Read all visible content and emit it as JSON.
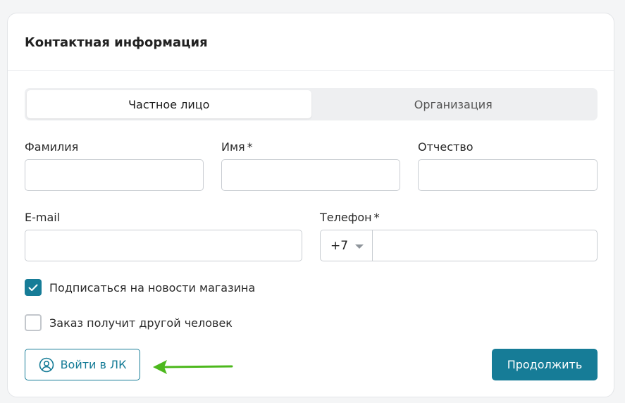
{
  "section": {
    "title": "Контактная информация"
  },
  "tabs": [
    {
      "label": "Частное лицо",
      "active": true
    },
    {
      "label": "Организация",
      "active": false
    }
  ],
  "fields": {
    "last_name": {
      "label": "Фамилия",
      "value": ""
    },
    "first_name": {
      "label": "Имя",
      "required": "*",
      "value": ""
    },
    "middle_name": {
      "label": "Отчество",
      "value": ""
    },
    "email": {
      "label": "E-mail",
      "value": ""
    },
    "phone": {
      "label": "Телефон",
      "required": "*",
      "prefix": "+7",
      "value": ""
    }
  },
  "checkboxes": [
    {
      "label": "Подписаться на новости магазина",
      "checked": true
    },
    {
      "label": "Заказ получит другой человек",
      "checked": false
    }
  ],
  "buttons": {
    "login": {
      "label": "Войти в ЛК",
      "icon": "user-circle-icon"
    },
    "continue": {
      "label": "Продолжить"
    }
  },
  "colors": {
    "accent": "#167c97",
    "annotation_arrow": "#4cb81c"
  }
}
